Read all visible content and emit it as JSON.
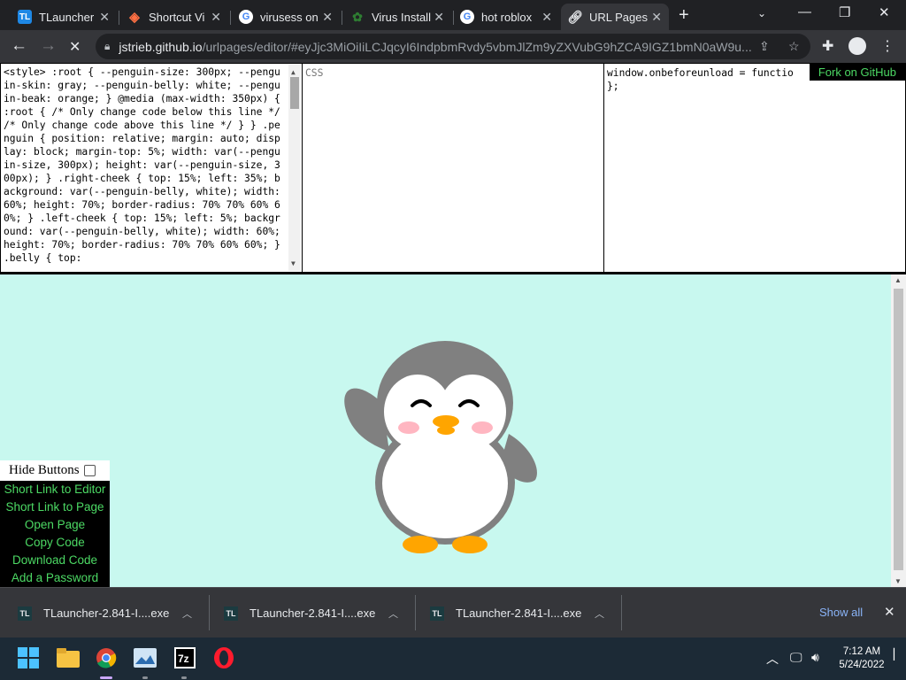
{
  "browser": {
    "tabs": [
      {
        "title": "TLauncher",
        "icon": "tlauncher-icon",
        "active": false
      },
      {
        "title": "Shortcut Vi",
        "icon": "shortcut-icon",
        "active": false
      },
      {
        "title": "virusess on",
        "icon": "google-icon",
        "active": false
      },
      {
        "title": "Virus Install",
        "icon": "virus-icon",
        "active": false
      },
      {
        "title": "hot roblox",
        "icon": "google-icon",
        "active": false
      },
      {
        "title": "URL Pages",
        "icon": "link-icon",
        "active": true
      }
    ],
    "url_host": "jstrieb.github.io",
    "url_path": "/urlpages/editor/#eyJjc3MiOiIiLCJqcyI6IndpbmRvdy5vbmJlZm9yZXVubG9hZCA9IGZ1bmN0aW9u..."
  },
  "editor": {
    "html_code": "<style> :root { --penguin-size: 300px; --penguin-skin: gray; --penguin-belly: white; --penguin-beak: orange; } @media (max-width: 350px) { :root { /* Only change code below this line */ /* Only change code above this line */ } } .penguin { position: relative; margin: auto; display: block; margin-top: 5%; width: var(--penguin-size, 300px); height: var(--penguin-size, 300px); } .right-cheek { top: 15%; left: 35%; background: var(--penguin-belly, white); width: 60%; height: 70%; border-radius: 70% 70% 60% 60%; } .left-cheek { top: 15%; left: 5%; background: var(--penguin-belly, white); width: 60%; height: 70%; border-radius: 70% 70% 60% 60%; } .belly { top:",
    "css_placeholder": "CSS",
    "js_line1": "window.onbeforeunload = functio",
    "js_line2": "};",
    "fork_label": "Fork on GitHub"
  },
  "side_panel": {
    "hide_label": "Hide Buttons",
    "buttons": [
      "Short Link to Editor",
      "Short Link to Page",
      "Open Page",
      "Copy Code",
      "Download Code",
      "Add a Password"
    ]
  },
  "downloads": {
    "items": [
      {
        "name": "TLauncher-2.841-I....exe"
      },
      {
        "name": "TLauncher-2.841-I....exe"
      },
      {
        "name": "TLauncher-2.841-I....exe"
      }
    ],
    "show_all": "Show all"
  },
  "taskbar": {
    "time": "7:12 AM",
    "date": "5/24/2022",
    "apps": [
      "windows-start-icon",
      "file-explorer-icon",
      "chrome-icon",
      "photos-icon",
      "7zip-icon",
      "opera-icon"
    ]
  },
  "colors": {
    "preview_bg": "#c8f8ef",
    "button_text": "#4cd964",
    "penguin_skin": "#808080",
    "penguin_beak": "#ffa500",
    "cheek_blush": "#ffb6c1"
  }
}
